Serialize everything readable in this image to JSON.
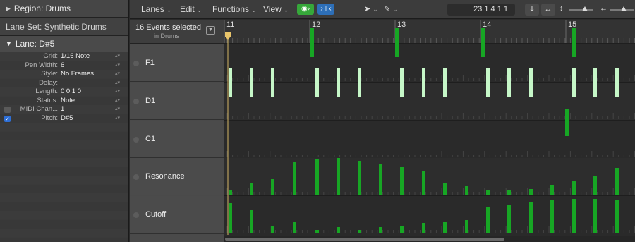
{
  "inspector": {
    "region_label": "Region: Drums",
    "lane_set_label": "Lane Set: Synthetic Drums",
    "lane_label": "Lane:  D#5",
    "params": [
      {
        "label": "Grid:",
        "value": "1/16 Note",
        "stepper": true
      },
      {
        "label": "Pen Width:",
        "value": "6",
        "stepper": true
      },
      {
        "label": "Style:",
        "value": "No Frames",
        "stepper": true
      },
      {
        "label": "Delay:",
        "value": "",
        "stepper": true
      },
      {
        "label": "Length:",
        "value": "0 0 1     0",
        "stepper": true
      },
      {
        "label": "Status:",
        "value": "Note",
        "stepper": true
      },
      {
        "label": "MIDI Chan...",
        "value": "1",
        "stepper": true,
        "checkbox": false
      },
      {
        "label": "Pitch:",
        "value": "D#5",
        "stepper": true,
        "checkbox": true
      }
    ]
  },
  "toolbar": {
    "lanes": "Lanes",
    "edit": "Edit",
    "functions": "Functions",
    "view": "View",
    "midi_in_label": "",
    "catch_label": "",
    "counter": "23  1 4 1 1",
    "colors": {
      "green_btn": "#36a83a",
      "blue_btn": "#2d6fb8"
    }
  },
  "selection": {
    "title": "16 Events selected",
    "subtitle": "in Drums"
  },
  "ruler": {
    "bars": [
      "11",
      "12",
      "13",
      "14",
      "15"
    ]
  },
  "lanes": [
    {
      "name": "F1"
    },
    {
      "name": "D1"
    },
    {
      "name": "C1"
    },
    {
      "name": "Resonance"
    },
    {
      "name": "Cutoff"
    }
  ],
  "colors": {
    "event_green": "#17a624",
    "event_light": "#c6f7c8",
    "playhead": "#e8c46a"
  }
}
